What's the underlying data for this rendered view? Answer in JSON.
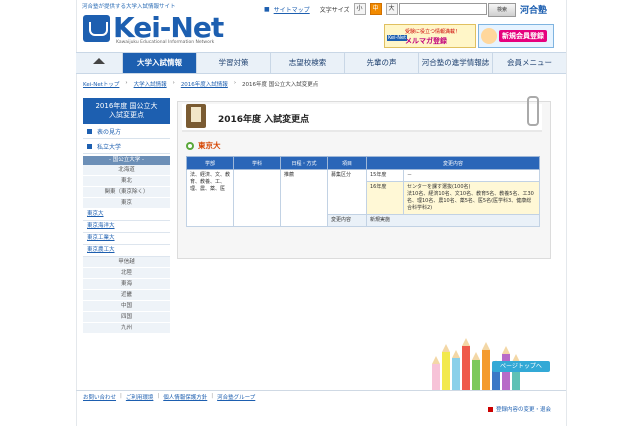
{
  "header": {
    "tagline": "河合塾が提供する大学入試情報サイト",
    "logo_text": "Kei-Net",
    "logo_sub": "Kawaijuku Educational Information Network",
    "sitemap": "サイトマップ",
    "font_size_label": "文字サイズ",
    "font_sizes": [
      "小",
      "中",
      "大"
    ],
    "search_button": "検索",
    "brand": "河合塾",
    "banner1_top": "受験に役立つ情報満載！",
    "banner1_logo": "Kei-Net",
    "banner1_main": "メルマガ登録",
    "banner2_main": "新規会員登録"
  },
  "nav": {
    "items": [
      "大学入試情報",
      "学習対策",
      "志望校検索",
      "先輩の声",
      "河合塾の進学情報誌",
      "会員メニュー"
    ]
  },
  "breadcrumb": [
    "Kei-Netトップ",
    "大学入試情報",
    "2016年度入試情報",
    "2016年度 国公立大入試変更点"
  ],
  "sidebar": {
    "heading": "2016年度 国公立大\n入試変更点",
    "links": [
      "表の見方",
      "私立大学"
    ],
    "sub_heading": "- 国公立大学 -",
    "regions_top": [
      "北海道",
      "東北",
      "関東（東京除く）",
      "東京"
    ],
    "universities": [
      "東京大",
      "東京海洋大",
      "東京工業大",
      "東京農工大"
    ],
    "regions_bottom": [
      "甲信越",
      "北陸",
      "東海",
      "近畿",
      "中国",
      "四国",
      "九州"
    ]
  },
  "main": {
    "title": "2016年度 入試変更点",
    "university": "東京大",
    "table_headers": [
      "学部",
      "学科",
      "日程・方式",
      "項目",
      "変更内容"
    ],
    "row": {
      "faculty": "法、経済、文、教育、教養、工、理、農、薬、医",
      "department": "",
      "schedule": "推薦",
      "item": "募集区分",
      "y15_label": "15年度",
      "y15_value": "－",
      "y16_label": "16年度",
      "y16_value": "センターを課す選抜(100名)\n法10名、経済10名、文10名、教育5名、教養5名、工30名、理10名、農10名、薬5名、医5名(医学科3、健康総合科学科2)",
      "change_label": "変更内容",
      "change_value": "新規実施"
    }
  },
  "pagetop": "ページトップへ",
  "footer": {
    "links": [
      "お問い合わせ",
      "ご利用環境",
      "個人情報保護方針",
      "河合塾グループ"
    ],
    "right_link": "登録内容の変更・退会"
  },
  "colors": {
    "brand_blue": "#1d5fb0",
    "accent_orange": "#d54400",
    "pencils": [
      "#f7c3d8",
      "#f2e94c",
      "#8ad0ea",
      "#ef5a4a",
      "#7cc95c",
      "#f49a2e",
      "#3b78c6",
      "#b86bc8",
      "#5fc1b5"
    ]
  }
}
